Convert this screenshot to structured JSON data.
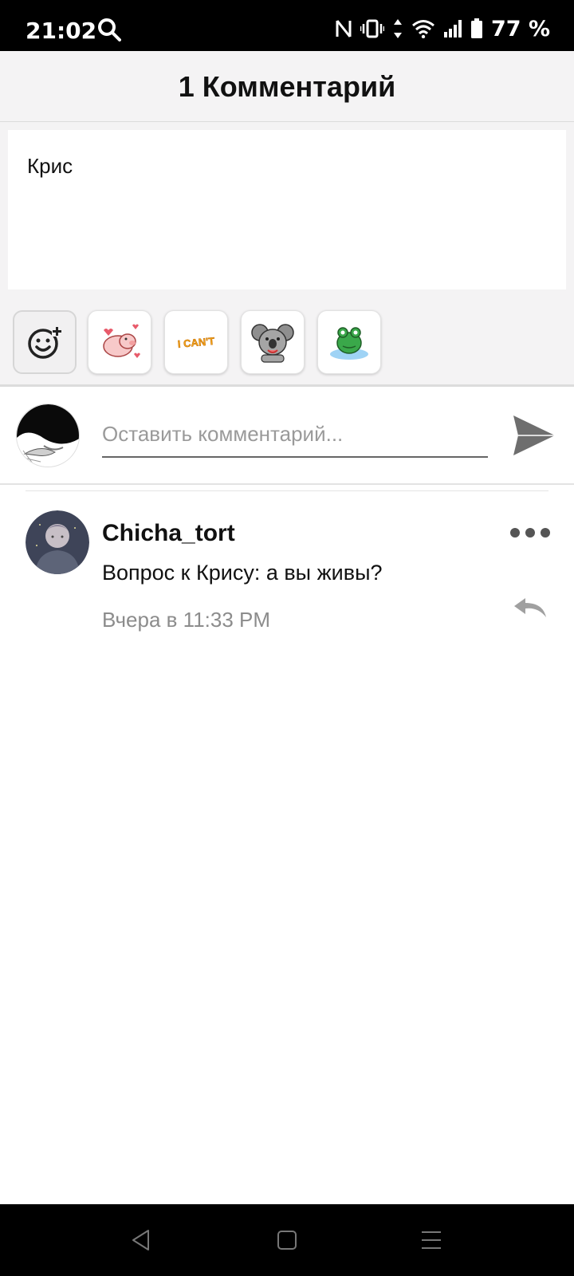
{
  "status_bar": {
    "time": "21:02",
    "battery": "77 %"
  },
  "header": {
    "title": "1 Комментарий"
  },
  "post": {
    "text": "Крис"
  },
  "stickers": [
    {
      "name": "add-sticker",
      "icon": "smiley-plus-icon"
    },
    {
      "name": "pig-hearts",
      "icon": "pig-sticker"
    },
    {
      "name": "i-cant",
      "label": "I CAN'T",
      "icon": "i-cant-sticker"
    },
    {
      "name": "koala",
      "icon": "koala-sticker"
    },
    {
      "name": "frog",
      "icon": "frog-sticker"
    }
  ],
  "composer": {
    "placeholder": "Оставить комментарий..."
  },
  "comments": [
    {
      "user": "Chicha_tort",
      "text": "Вопрос к Крису: а вы живы?",
      "time": "Вчера в 11:33 PM"
    }
  ],
  "colors": {
    "header_bg": "#f4f3f4",
    "text": "#111111",
    "muted": "#8c8c8c",
    "send_icon": "#6e6e6e"
  }
}
